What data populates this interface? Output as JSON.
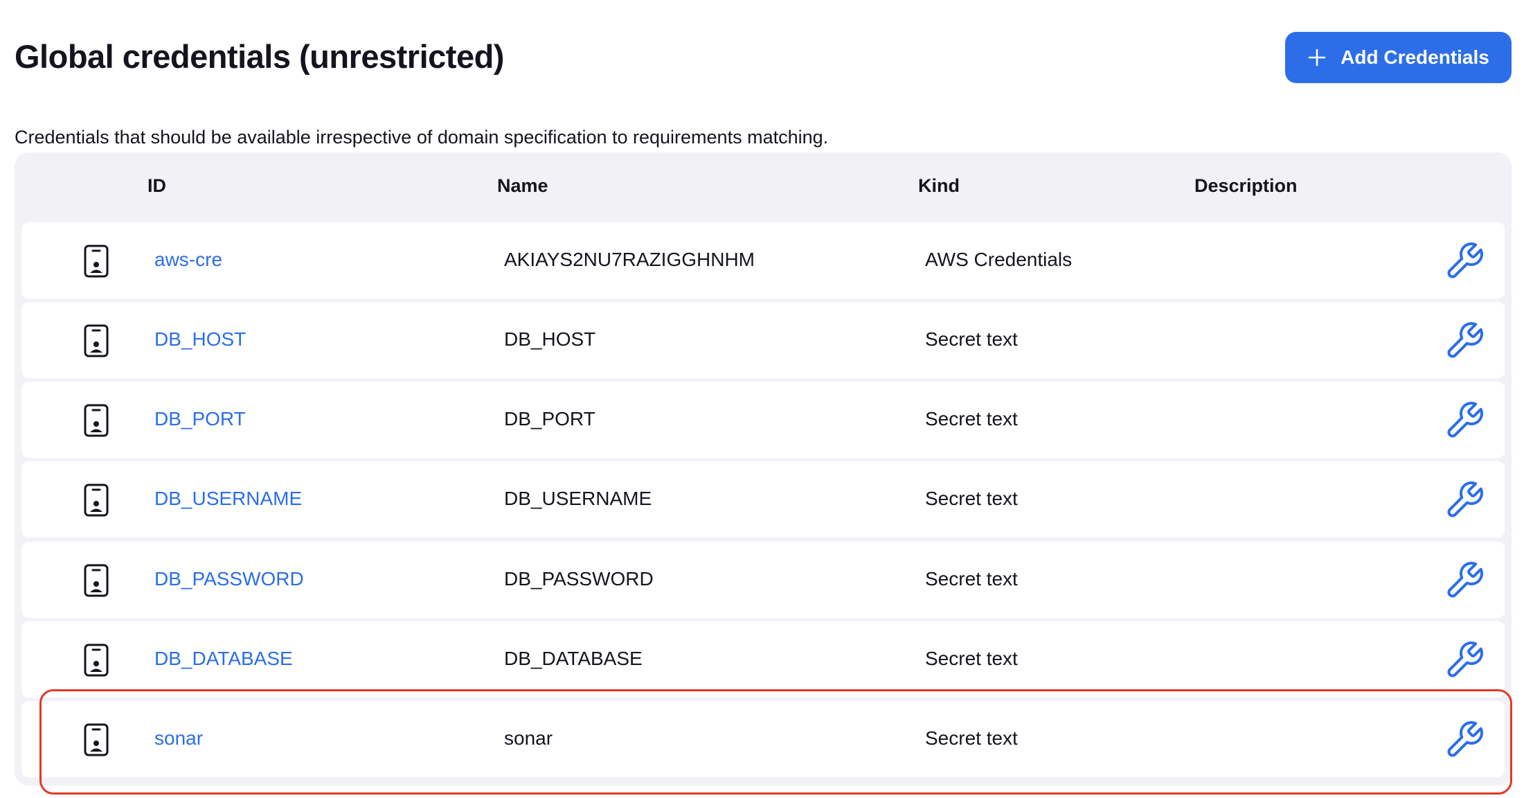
{
  "page": {
    "title": "Global credentials (unrestricted)",
    "description": "Credentials that should be available irrespective of domain specification to requirements matching.",
    "add_button_label": "Add Credentials",
    "add_button_icon": "plus-icon",
    "colors": {
      "accent": "#2b6ee8",
      "highlight": "#e03a26",
      "table_bg": "#f2f2f6"
    }
  },
  "table": {
    "columns": {
      "id": "ID",
      "name": "Name",
      "kind": "Kind",
      "description": "Description"
    },
    "rows": [
      {
        "id": "aws-cre",
        "name": "AKIAYS2NU7RAZIGGHNHM",
        "kind": "AWS Credentials",
        "description": ""
      },
      {
        "id": "DB_HOST",
        "name": "DB_HOST",
        "kind": "Secret text",
        "description": ""
      },
      {
        "id": "DB_PORT",
        "name": "DB_PORT",
        "kind": "Secret text",
        "description": ""
      },
      {
        "id": "DB_USERNAME",
        "name": "DB_USERNAME",
        "kind": "Secret text",
        "description": ""
      },
      {
        "id": "DB_PASSWORD",
        "name": "DB_PASSWORD",
        "kind": "Secret text",
        "description": ""
      },
      {
        "id": "DB_DATABASE",
        "name": "DB_DATABASE",
        "kind": "Secret text",
        "description": ""
      },
      {
        "id": "sonar",
        "name": "sonar",
        "kind": "Secret text",
        "description": ""
      }
    ],
    "row_icon": "credential-badge-icon",
    "action_icon": "wrench-icon"
  }
}
